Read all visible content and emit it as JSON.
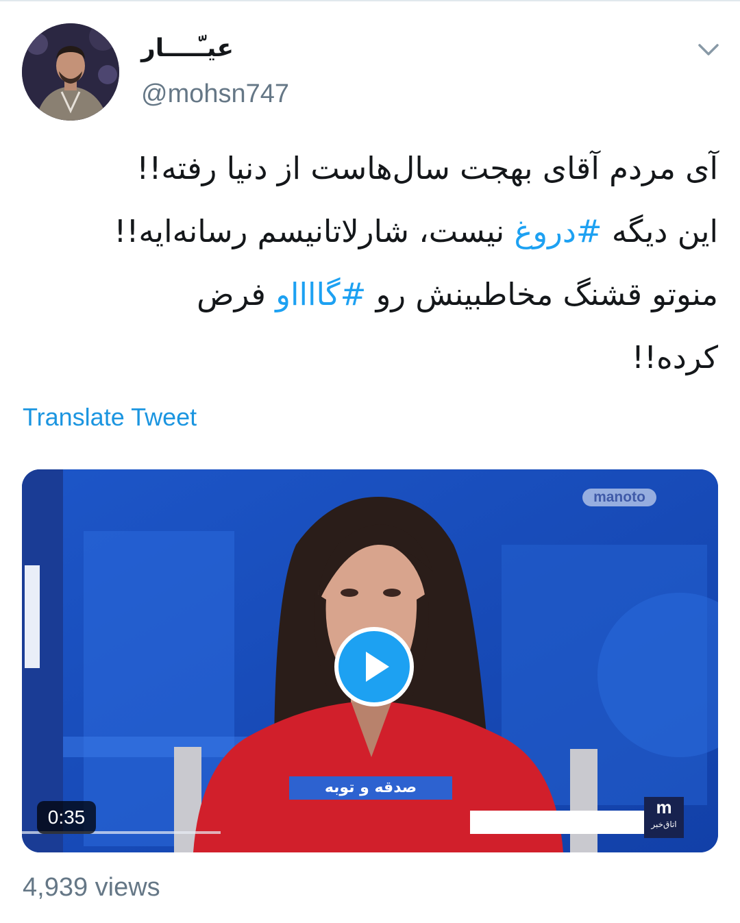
{
  "tweet": {
    "display_name": "عیـّــــار",
    "handle": "@mohsn747",
    "text_lines": [
      [
        {
          "text": "آی مردم آقای بهجت سال‌هاست از دنیا رفته!!"
        }
      ],
      [
        {
          "text": "این دیگه "
        },
        {
          "text": "#دروغ",
          "hashtag": true
        },
        {
          "text": " نیست، شارلاتانیسم رسانه‌ایه!!"
        }
      ],
      [
        {
          "text": "منوتو قشنگ مخاطبینش رو "
        },
        {
          "text": "#گااااو",
          "hashtag": true
        },
        {
          "text": " فرض"
        }
      ],
      [
        {
          "text": "کرده!!"
        }
      ]
    ],
    "translate_label": "Translate Tweet",
    "views": "4,939 views",
    "menu_icon": "chevron-down-icon"
  },
  "video": {
    "duration": "0:35",
    "brand_watermark": "manoto",
    "lower_third": "صدقه و توبه",
    "channel_logo_letter": "m",
    "channel_logo_text": "اتاق‌خبر",
    "play_icon": "play-icon"
  },
  "colors": {
    "link": "#1da1f2",
    "secondary_text": "#657786",
    "primary_text": "#14171a",
    "video_background": "#1748b8"
  }
}
